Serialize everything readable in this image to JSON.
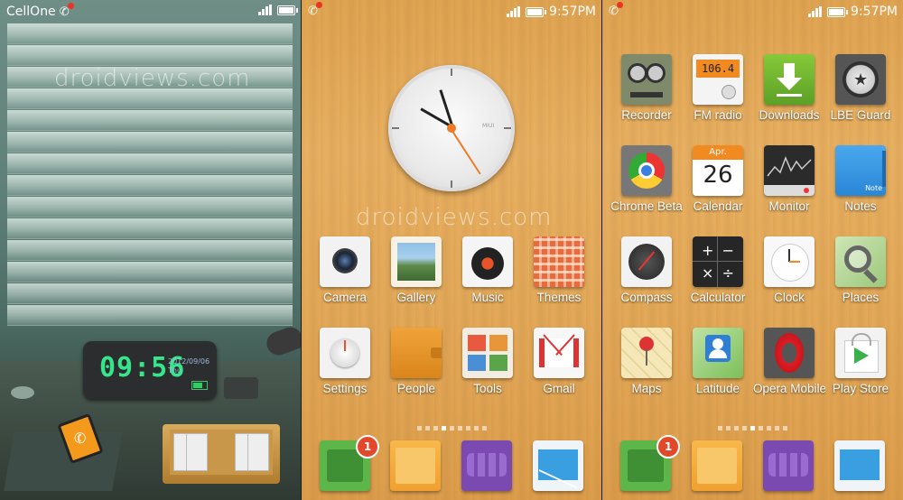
{
  "watermark": "droidviews.com",
  "lockscreen": {
    "carrier": "CellOne",
    "clock_time": "09:56",
    "clock_date": "2012/09/06",
    "clock_day": "Thu"
  },
  "screen2": {
    "time": "9:57PM",
    "clock_brand": "MIUI",
    "apps": [
      "Camera",
      "Gallery",
      "Music",
      "Themes",
      "Settings",
      "People",
      "Tools",
      "Gmail"
    ],
    "dock_badge": "1"
  },
  "screen3": {
    "time": "9:57PM",
    "apps": [
      "Recorder",
      "FM radio",
      "Downloads",
      "LBE Guard",
      "Chrome Beta",
      "Calendar",
      "Monitor",
      "Notes",
      "Compass",
      "Calculator",
      "Clock",
      "Places",
      "Maps",
      "Latitude",
      "Opera Mobile",
      "Play Store"
    ],
    "fm_freq": "106.4",
    "calendar_month": "Apr.",
    "calendar_day": "26",
    "notes_tag": "Note",
    "dock_badge": "1"
  },
  "colors": {
    "wood": "#e4aa5a",
    "badge": "#e2492b",
    "digital": "#36e68a"
  }
}
